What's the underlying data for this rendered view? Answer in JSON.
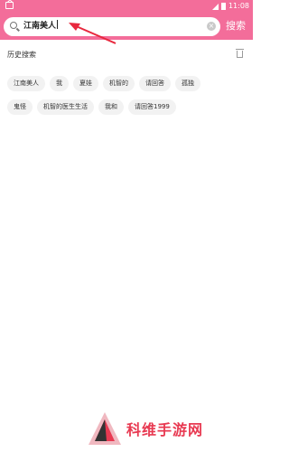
{
  "status_bar": {
    "time": "11:08"
  },
  "search": {
    "query": "江南美人",
    "button_label": "搜索"
  },
  "history": {
    "title": "历史搜索",
    "rows": [
      [
        "江南美人",
        "我",
        "夏娃",
        "机智的",
        "请回答",
        "孤独"
      ],
      [
        "鬼怪",
        "机智的医生生活",
        "我和",
        "请回答1999"
      ]
    ]
  },
  "watermark": {
    "text": "科维手游网"
  },
  "colors": {
    "accent": "#f36d9a",
    "tag_bg": "#f2f2f2",
    "watermark": "#e83a52"
  }
}
